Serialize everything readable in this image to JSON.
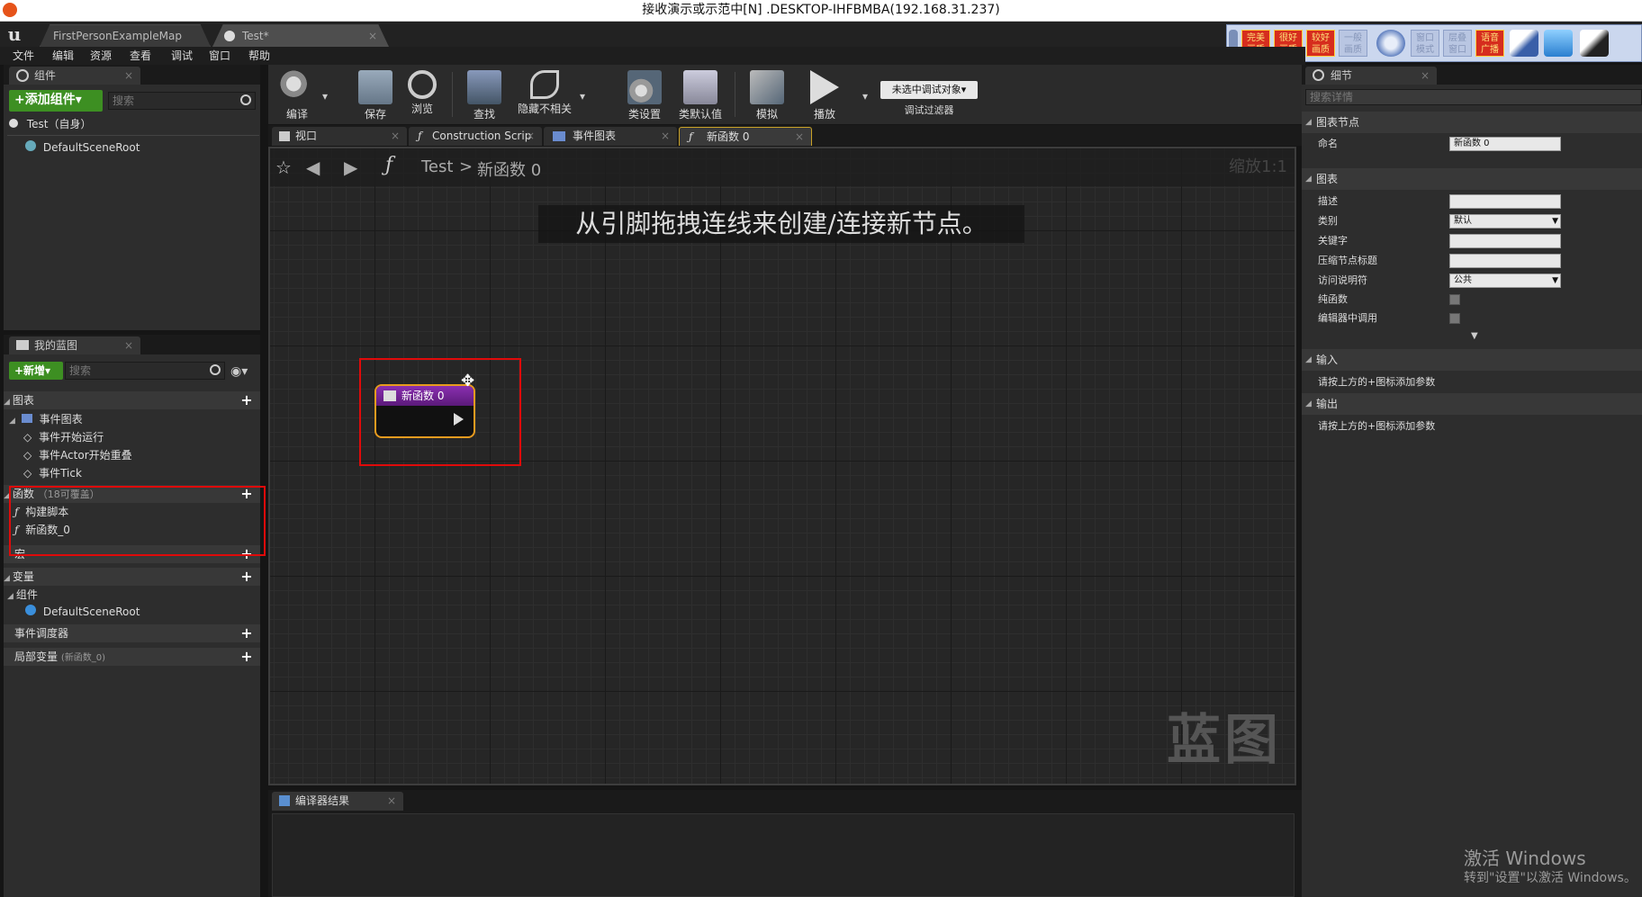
{
  "remote_title": "接收演示或示范中[N] .DESKTOP-IHFBMBA(192.168.31.237)",
  "doc_tabs": [
    "FirstPersonExampleMap",
    "Test*"
  ],
  "menu": [
    "文件",
    "编辑",
    "资源",
    "查看",
    "调试",
    "窗口",
    "帮助"
  ],
  "rd_buttons": [
    "完美\n画质",
    "很好\n画质",
    "较好\n画质",
    "一般\n画质",
    "窗口\n模式",
    "层叠\n窗口",
    "语音\n广播"
  ],
  "components": {
    "tab": "组件",
    "add_button": "+添加组件▾",
    "search_placeholder": "搜索",
    "root": "Test（自身）",
    "child": "DefaultSceneRoot"
  },
  "toolbar": {
    "items": [
      "编译",
      "保存",
      "浏览",
      "查找",
      "隐藏不相关",
      "类设置",
      "类默认值",
      "模拟",
      "播放"
    ],
    "debug_dropdown": "未选中调试对象▾",
    "debug_filter": "调试过滤器"
  },
  "graph_tabs": [
    "视口",
    "Construction Scrip",
    "事件图表",
    "新函数 0"
  ],
  "graph": {
    "breadcrumb_root": "Test",
    "breadcrumb_sep": ">",
    "breadcrumb_current": "新函数 0",
    "zoom": "缩放1:1",
    "hint": "从引脚拖拽连线来创建/连接新节点。",
    "watermark": "蓝图",
    "node_title": "新函数 0"
  },
  "my_blueprint": {
    "tab": "我的蓝图",
    "new_button": "+新增▾",
    "search_placeholder": "搜索",
    "graphs_label": "图表",
    "event_graph": "事件图表",
    "events": [
      "事件开始运行",
      "事件Actor开始重叠",
      "事件Tick"
    ],
    "functions_label": "函数",
    "functions_note": "（18可覆盖）",
    "functions": [
      "构建脚本",
      "新函数_0"
    ],
    "macros_label": "宏",
    "variables_label": "变量",
    "components_label": "组件",
    "component_item": "DefaultSceneRoot",
    "dispatchers_label": "事件调度器",
    "local_vars_label": "局部变量",
    "local_vars_note": "(新函数_0)"
  },
  "details": {
    "tab": "细节",
    "search_placeholder": "搜索详情",
    "graph_node_section": "图表节点",
    "name_label": "命名",
    "name_value": "新函数 0",
    "graph_section": "图表",
    "desc_label": "描述",
    "category_label": "类别",
    "category_value": "默认",
    "keyword_label": "关键字",
    "compact_label": "压缩节点标题",
    "access_label": "访问说明符",
    "access_value": "公共",
    "pure_label": "纯函数",
    "editor_call_label": "编辑器中调用",
    "inputs_section": "输入",
    "inputs_hint": "请按上方的+图标添加参数",
    "outputs_section": "输出",
    "outputs_hint": "请按上方的+图标添加参数"
  },
  "compiler": {
    "tab": "编译器结果"
  },
  "windows_activation": {
    "line1": "激活 Windows",
    "line2": "转到\"设置\"以激活 Windows。"
  }
}
